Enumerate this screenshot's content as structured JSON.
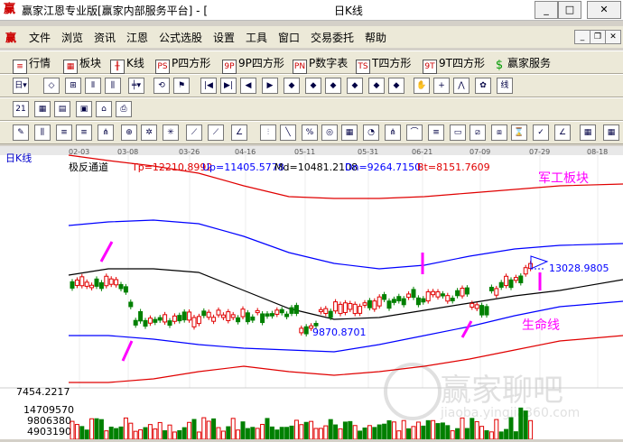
{
  "window": {
    "title": "赢家江恩专业版[赢家内部服务平台] - [",
    "title_suffix": "日K线",
    "app_icon": "赢"
  },
  "menu": [
    "文件",
    "浏览",
    "资讯",
    "江恩",
    "公式选股",
    "设置",
    "工具",
    "窗口",
    "交易委托",
    "帮助"
  ],
  "toolbar1": [
    "行情",
    "板块",
    "K线",
    "P四方形",
    "9P四方形",
    "P数字表",
    "T四方形",
    "9T四方形",
    "赢家服务"
  ],
  "chart": {
    "period": "日K线",
    "indicator_name": "极反通道",
    "params": {
      "tp": "Tp=12210.8992",
      "up": "Up=11405.5778",
      "md": "Md=10481.2108",
      "dn": "Dn=9264.7150",
      "bt": "Bt=8151.7609"
    },
    "date_labels": [
      "02-03",
      "03-08",
      "03-26",
      "04-16",
      "05-11",
      "05-31",
      "06-21",
      "07-09",
      "07-29",
      "08-18"
    ],
    "annotation_sector": "军工板块",
    "annotation_life": "生命线",
    "low_value": "9870.8701",
    "current_value": "13028.9805",
    "vol_axis": [
      "7454.2217",
      "14709570",
      "9806380",
      "4903190"
    ],
    "watermark": "赢家聊吧",
    "watermark_url": "jiaoba.yingjia360.com"
  },
  "colors": {
    "outer_band": "#e00000",
    "inner_band": "#0000ff",
    "middle_line": "#000000",
    "annotation": "#ff00ff",
    "candle_up": "#e00000",
    "candle_down": "#008000"
  }
}
